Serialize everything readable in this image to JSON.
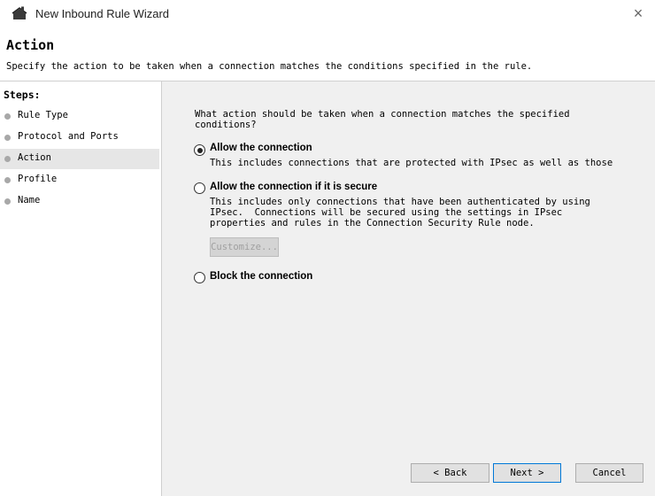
{
  "window": {
    "title": "New Inbound Rule Wizard",
    "close_glyph": "×",
    "icon": "firewall-icon"
  },
  "header": {
    "title": "Action",
    "subtitle": "Specify the action to be taken when a connection matches the conditions specified in the rule."
  },
  "steps": {
    "heading": "Steps:",
    "items": [
      {
        "label": "Rule Type"
      },
      {
        "label": "Protocol and Ports"
      },
      {
        "label": "Action",
        "active": true
      },
      {
        "label": "Profile"
      },
      {
        "label": "Name"
      }
    ]
  },
  "main": {
    "question": "What action should be taken when a connection matches the specified\nconditions?",
    "options": [
      {
        "label": "Allow the connection",
        "description": "This includes connections that are protected with IPsec as well as those",
        "selected": true
      },
      {
        "label": "Allow the connection if it is secure",
        "description": "This includes only connections that have been authenticated by using\nIPsec.  Connections will be secured using the settings in IPsec\nproperties and rules in the Connection Security Rule node.",
        "selected": false
      },
      {
        "label": "Block the connection",
        "selected": false
      }
    ],
    "customize_label": "Customize..."
  },
  "footer": {
    "back_label": "< Back",
    "next_label": "Next >",
    "cancel_label": "Cancel"
  }
}
